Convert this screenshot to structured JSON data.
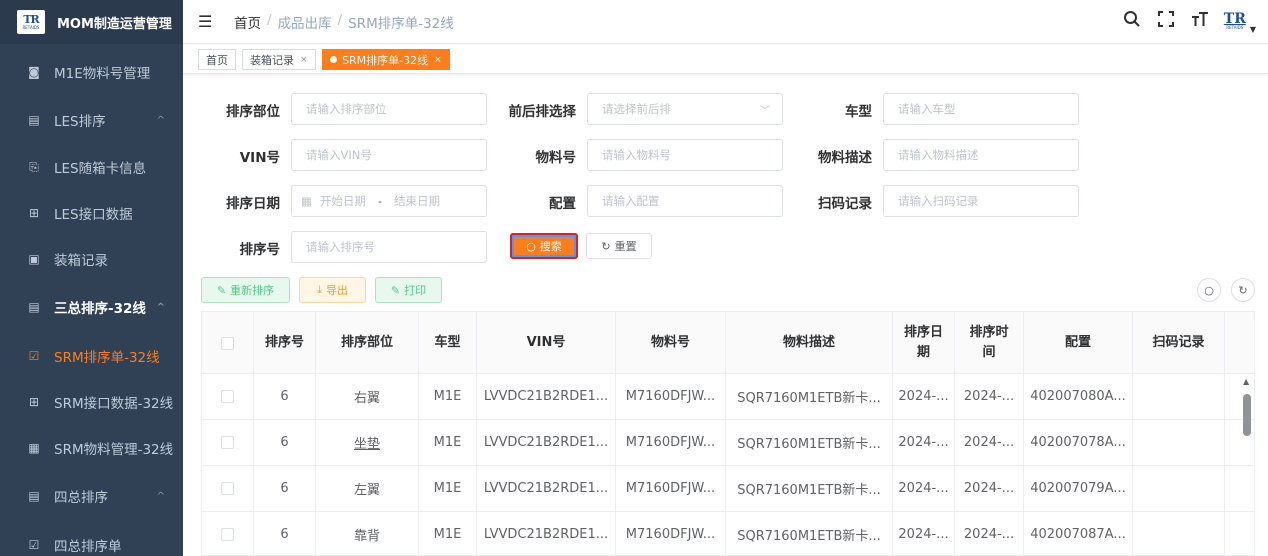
{
  "app": {
    "title": "MOM制造运营管理",
    "logo_text": "TR",
    "logo_sub": "RETAIDS"
  },
  "sidebar": {
    "items": [
      {
        "label": "M1E物料号管理",
        "icon": "barcode-icon"
      },
      {
        "label": "LES排序",
        "icon": "list-icon",
        "arrow": "^"
      },
      {
        "label": "LES随箱卡信息",
        "icon": "card-icon"
      },
      {
        "label": "LES接口数据",
        "icon": "grid-icon"
      },
      {
        "label": "装箱记录",
        "icon": "doc-icon"
      },
      {
        "label": "三总排序-32线",
        "icon": "list-icon",
        "arrow": "^"
      },
      {
        "label": "SRM排序单-32线",
        "icon": "check-icon"
      },
      {
        "label": "SRM接口数据-32线",
        "icon": "grid-icon"
      },
      {
        "label": "SRM物料管理-32线",
        "icon": "calendar-icon"
      },
      {
        "label": "四总排序",
        "icon": "list-icon",
        "arrow": "^"
      },
      {
        "label": "四总排序单",
        "icon": "check-icon"
      }
    ]
  },
  "navbar": {
    "breadcrumb": [
      "首页",
      "成品出库",
      "SRM排序单-32线"
    ],
    "sep": "/",
    "logo_text": "TR"
  },
  "tabs": [
    {
      "label": "首页"
    },
    {
      "label": "装箱记录",
      "close": "×"
    },
    {
      "label": "SRM排序单-32线",
      "close": "×"
    }
  ],
  "filters": {
    "dept_label": "排序部位",
    "dept_ph": "请输入排序部位",
    "frontback_label": "前后排选择",
    "frontback_ph": "请选择前后排",
    "model_label": "车型",
    "model_ph": "请输入车型",
    "vin_label": "VIN号",
    "vin_ph": "请输入VIN号",
    "material_label": "物料号",
    "material_ph": "请输入物料号",
    "desc_label": "物料描述",
    "desc_ph": "请输入物料描述",
    "date_label": "排序日期",
    "date_start": "开始日期",
    "date_dash": "-",
    "date_end": "结束日期",
    "config_label": "配置",
    "config_ph": "请输入配置",
    "scan_label": "扫码记录",
    "scan_ph": "请输入扫码记录",
    "seq_label": "排序号",
    "seq_ph": "请输入排序号",
    "search_btn": "搜索",
    "reset_btn": "重置"
  },
  "toolbar": {
    "resort": "重新排序",
    "export": "导出",
    "print": "打印"
  },
  "table": {
    "headers": [
      "排序号",
      "排序部位",
      "车型",
      "VIN号",
      "物料号",
      "物料描述",
      "排序日期",
      "排序时间",
      "配置",
      "扫码记录"
    ],
    "rows": [
      [
        "6",
        "右翼",
        "M1E",
        "LVVDC21B2RDE1...",
        "M7160DFJW...",
        "SQR7160M1ETB新卡...",
        "2024-...",
        "2024-...",
        "402007080A...",
        ""
      ],
      [
        "6",
        "坐垫",
        "M1E",
        "LVVDC21B2RDE1...",
        "M7160DFJW...",
        "SQR7160M1ETB新卡...",
        "2024-...",
        "2024-...",
        "402007078A...",
        ""
      ],
      [
        "6",
        "左翼",
        "M1E",
        "LVVDC21B2RDE1...",
        "M7160DFJW...",
        "SQR7160M1ETB新卡...",
        "2024-...",
        "2024-...",
        "402007079A...",
        ""
      ],
      [
        "6",
        "靠背",
        "M1E",
        "LVVDC21B2RDE1...",
        "M7160DFJW...",
        "SQR7160M1ETB新卡...",
        "2024-...",
        "2024-...",
        "402007087A...",
        ""
      ]
    ]
  },
  "colors": {
    "accent": "#ff7d1a",
    "sidebar_bg": "#304156"
  }
}
